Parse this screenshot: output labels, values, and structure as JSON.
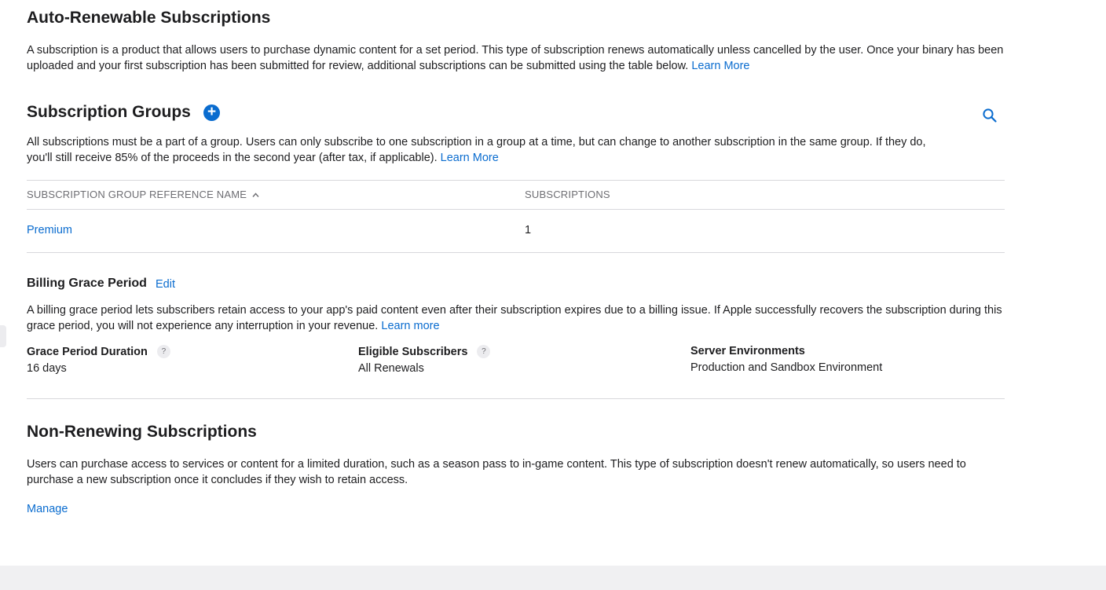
{
  "auto_renewable": {
    "title": "Auto-Renewable Subscriptions",
    "description": "A subscription is a product that allows users to purchase dynamic content for a set period. This type of subscription renews automatically unless cancelled by the user. Once your binary has been uploaded and your first subscription has been submitted for review, additional subscriptions can be submitted using the table below.",
    "learn_more": "Learn More"
  },
  "subscription_groups": {
    "title": "Subscription Groups",
    "add_icon": "plus-circle-icon",
    "search_icon": "search-icon",
    "description": "All subscriptions must be a part of a group. Users can only subscribe to one subscription in a group at a time, but can change to another subscription in the same group. If they do, you'll still receive 85% of the proceeds in the second year (after tax, if applicable).",
    "learn_more": "Learn More",
    "table": {
      "columns": [
        "SUBSCRIPTION GROUP REFERENCE NAME",
        "SUBSCRIPTIONS"
      ],
      "sort_indicator": "^",
      "rows": [
        {
          "name": "Premium",
          "count": "1"
        }
      ]
    }
  },
  "billing_grace": {
    "title": "Billing Grace Period",
    "edit_label": "Edit",
    "description": "A billing grace period lets subscribers retain access to your app's paid content even after their subscription expires due to a billing issue. If Apple successfully recovers the subscription during this grace period, you will not experience any interruption in your revenue.",
    "learn_more": "Learn more",
    "help_glyph": "?",
    "fields": [
      {
        "label": "Grace Period Duration",
        "value": "16 days"
      },
      {
        "label": "Eligible Subscribers",
        "value": "All Renewals"
      },
      {
        "label": "Server Environments",
        "value": "Production and Sandbox Environment"
      }
    ]
  },
  "non_renewing": {
    "title": "Non-Renewing Subscriptions",
    "description": "Users can purchase access to services or content for a limited duration, such as a season pass to in-game content. This type of subscription doesn't renew automatically, so users need to purchase a new subscription once it concludes if they wish to retain access.",
    "manage_label": "Manage"
  },
  "colors": {
    "link": "#0a6ccf",
    "text": "#1d1d1f",
    "muted": "#6e6e73",
    "divider": "#d8d8dc"
  }
}
